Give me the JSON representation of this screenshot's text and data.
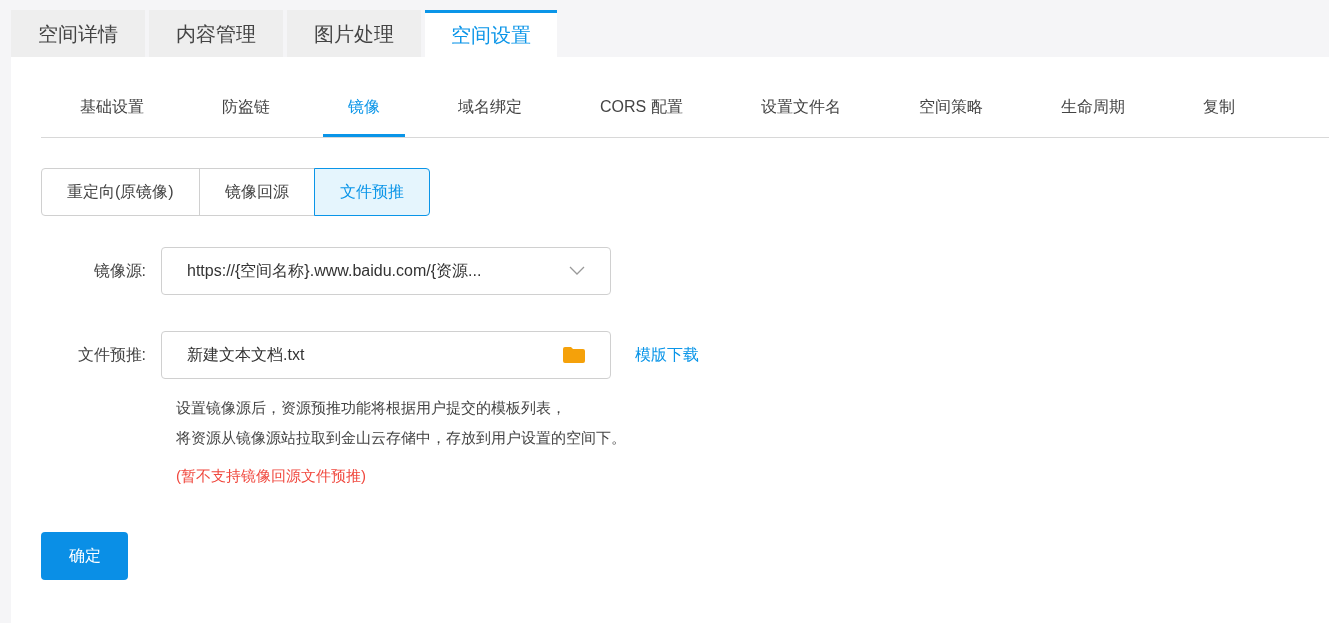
{
  "top_tabs": [
    {
      "label": "空间详情",
      "selected": false
    },
    {
      "label": "内容管理",
      "selected": false
    },
    {
      "label": "图片处理",
      "selected": false
    },
    {
      "label": "空间设置",
      "selected": true
    }
  ],
  "sub_tabs": [
    {
      "label": "基础设置",
      "selected": false
    },
    {
      "label": "防盗链",
      "selected": false
    },
    {
      "label": "镜像",
      "selected": true
    },
    {
      "label": "域名绑定",
      "selected": false
    },
    {
      "label": "CORS 配置",
      "selected": false
    },
    {
      "label": "设置文件名",
      "selected": false
    },
    {
      "label": "空间策略",
      "selected": false
    },
    {
      "label": "生命周期",
      "selected": false
    },
    {
      "label": "复制",
      "selected": false
    }
  ],
  "mode_buttons": [
    {
      "label": "重定向(原镜像)",
      "selected": false
    },
    {
      "label": "镜像回源",
      "selected": false
    },
    {
      "label": "文件预推",
      "selected": true
    }
  ],
  "form": {
    "mirror_source": {
      "label": "镜像源:",
      "value": "https://{空间名称}.www.baidu.com/{资源..."
    },
    "file_prepush": {
      "label": "文件预推:",
      "value": "新建文本文档.txt",
      "link": "模版下载"
    },
    "help_lines": [
      "设置镜像源后，资源预推功能将根据用户提交的模板列表，",
      "将资源从镜像源站拉取到金山云存储中，存放到用户设置的空间下。"
    ],
    "warning": "(暂不支持镜像回源文件预推)"
  },
  "confirm_button": "确定"
}
